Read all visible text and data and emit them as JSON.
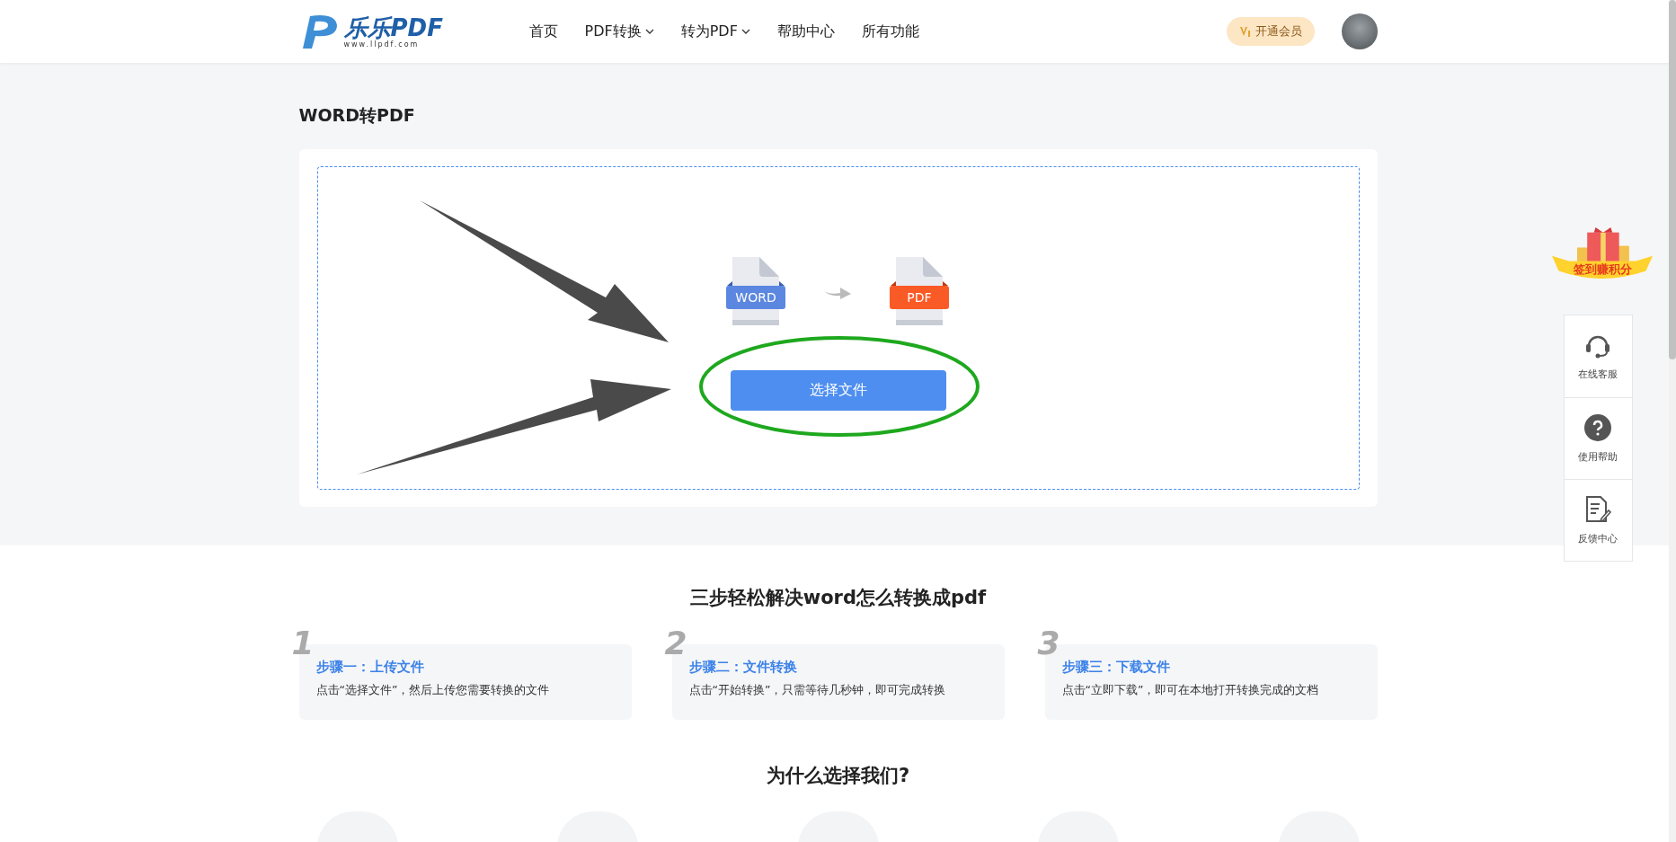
{
  "header": {
    "logo": {
      "name": "乐乐PDF",
      "url": "www.llpdf.com"
    },
    "nav": [
      {
        "label": "首页",
        "dropdown": false
      },
      {
        "label": "PDF转换",
        "dropdown": true
      },
      {
        "label": "转为PDF",
        "dropdown": true
      },
      {
        "label": "帮助中心",
        "dropdown": false
      },
      {
        "label": "所有功能",
        "dropdown": false
      }
    ],
    "vip_button": "开通会员"
  },
  "page_title": "WORD转PDF",
  "converter": {
    "from": "WORD",
    "to": "PDF",
    "button": "选择文件"
  },
  "steps_heading": "三步轻松解决word怎么转换成pdf",
  "steps": [
    {
      "number": "1",
      "title": "步骤一：上传文件",
      "text": "点击“选择文件”，然后上传您需要转换的文件"
    },
    {
      "number": "2",
      "title": "步骤二：文件转换",
      "text": "点击“开始转换”，只需等待几秒钟，即可完成转换"
    },
    {
      "number": "3",
      "title": "步骤三：下载文件",
      "text": "点击“立即下载”，即可在本地打开转换完成的文档"
    }
  ],
  "why_heading": "为什么选择我们?",
  "side_badge": "签到赚积分",
  "side_tools": [
    {
      "kind": "headset",
      "label": "在线客服"
    },
    {
      "kind": "help",
      "label": "使用帮助"
    },
    {
      "kind": "feedback",
      "label": "反馈中心"
    }
  ]
}
